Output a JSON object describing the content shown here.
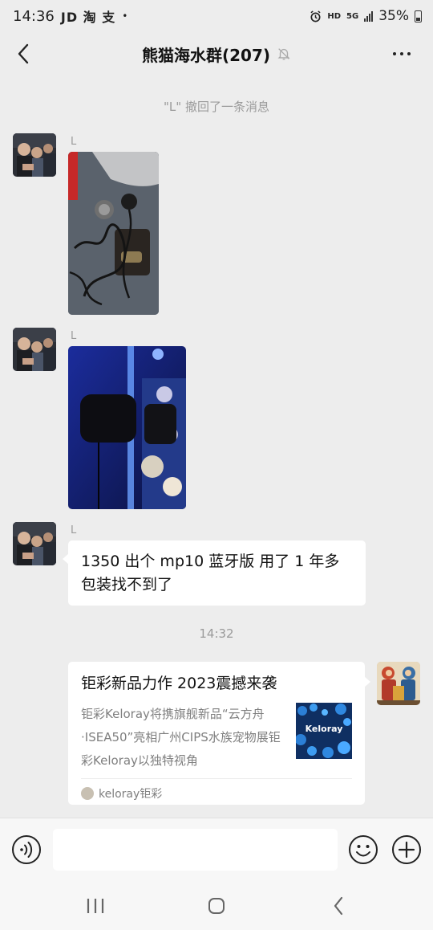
{
  "status_bar": {
    "time": "14:36",
    "apps": "JD 淘 支",
    "dot": "•",
    "hd": "HD",
    "network": "5G",
    "battery": "35%"
  },
  "nav": {
    "title": "熊猫海水群(207)",
    "muted_icon": "bell-off-icon",
    "more_icon": "more-icon"
  },
  "messages": {
    "recall_notice": "\"L\" 撤回了一条消息",
    "sender_1": "L",
    "sender_2": "L",
    "sender_3": "L",
    "text_message": "1350 出个 mp10 蓝牙版 用了 1 年多 包装找不到了",
    "timestamp": "14:32"
  },
  "card": {
    "title": "钜彩新品力作 2023震撼来袭",
    "description": "钜彩Keloray将携旗舰新品“云方舟·ISEA50”亮相广州CIPS水族宠物展钜彩Keloray以独特视角",
    "thumb_text": "Keloray",
    "source": "keloray钜彩"
  },
  "input": {
    "placeholder": ""
  },
  "colors": {
    "background": "#ededed",
    "bubble": "#ffffff",
    "meta_text": "#9a9a9a"
  }
}
